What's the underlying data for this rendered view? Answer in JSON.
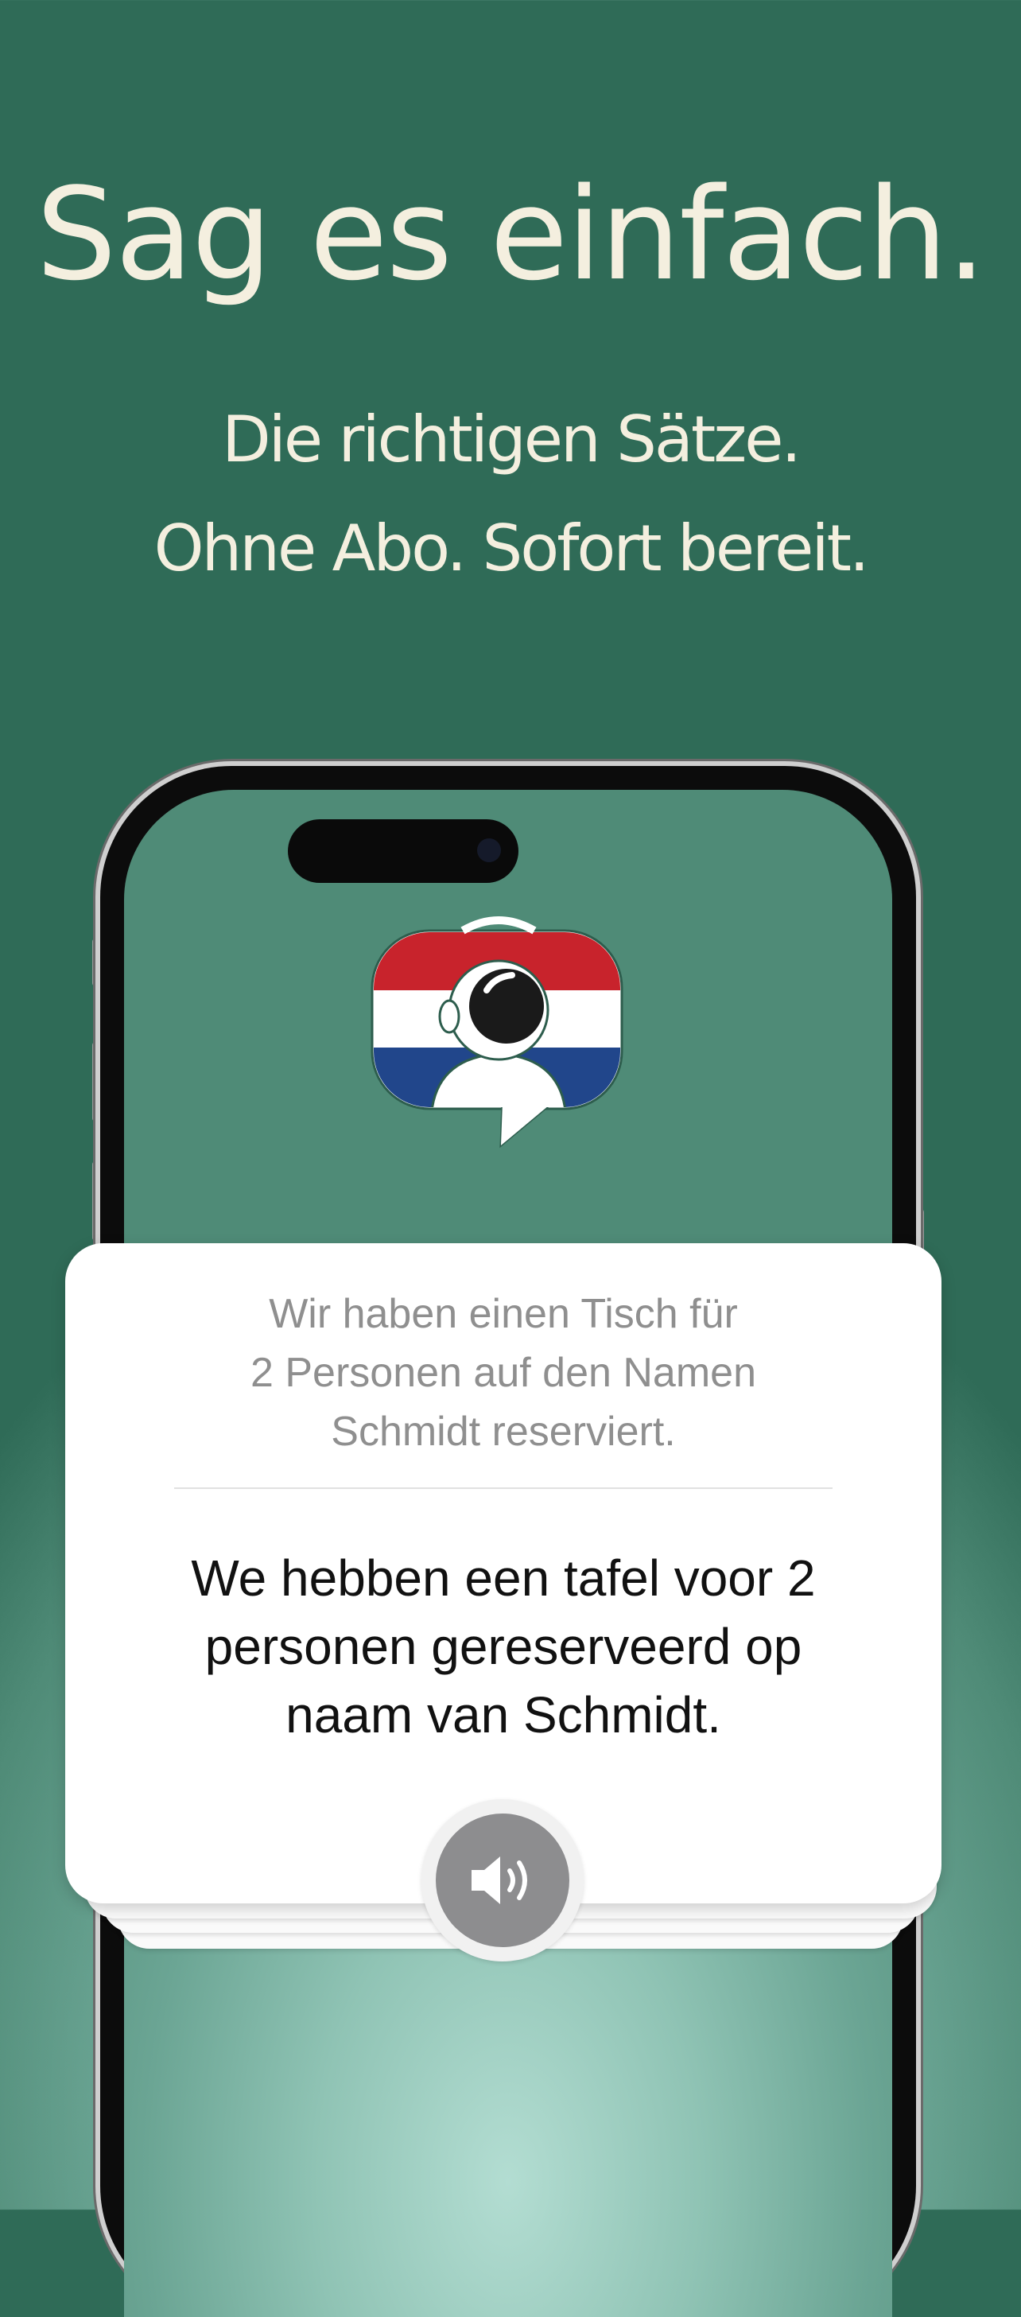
{
  "headline": "Sag es einfach.",
  "subtitle_line1": "Die richtigen Sätze.",
  "subtitle_line2": "Ohne Abo. Sofort bereit.",
  "app_icon": {
    "icon": "astronaut-speech-bubble-dutch-flag-icon",
    "flag_colors": [
      "#c8232c",
      "#ffffff",
      "#21468b"
    ]
  },
  "card": {
    "source_lines": [
      "Wir haben einen Tisch für",
      "2 Personen auf den Namen",
      "Schmidt reserviert."
    ],
    "target_lines": [
      "We hebben een tafel voor 2",
      "personen gereserveerd op",
      "naam van Schmidt."
    ],
    "speaker_icon": "speaker-icon"
  },
  "colors": {
    "background_top": "#2f6b57",
    "background_bottom": "#b3ddd2",
    "headline_text": "#f4efdf"
  }
}
